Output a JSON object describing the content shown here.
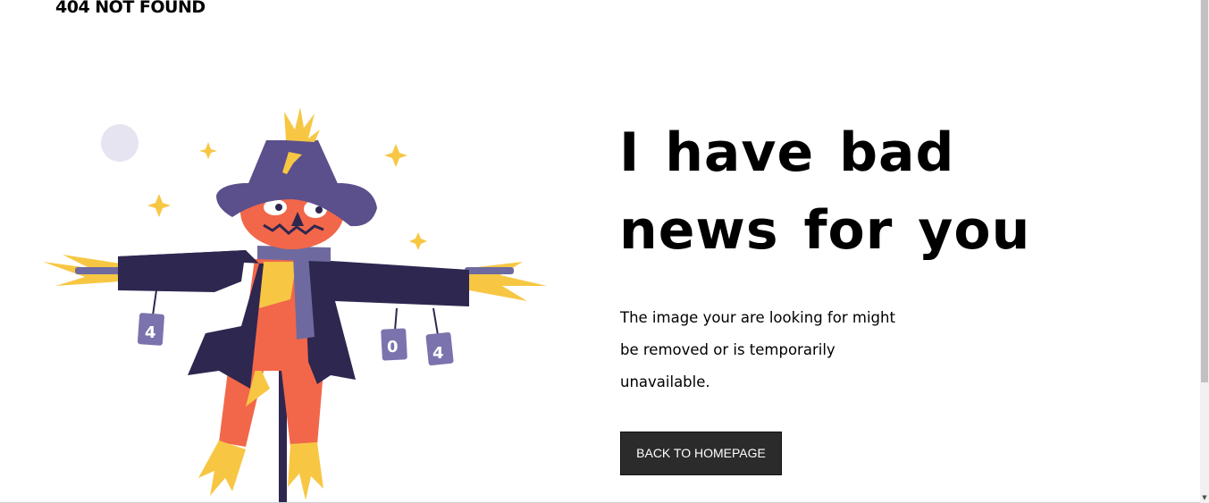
{
  "header": {
    "brand": "404 NOT FOUND"
  },
  "hero": {
    "headline": "I have bad news for you",
    "message": "The image your are looking for might be removed or is temporarily unavailable.",
    "button_label": "BACK TO HOMEPAGE"
  },
  "illustration": {
    "can_digits": [
      "4",
      "0",
      "4"
    ]
  },
  "colors": {
    "button_bg": "#2b2b2b",
    "hat": "#5b4f8c",
    "coat": "#2e2750",
    "face": "#f2674a",
    "straw": "#f7c744",
    "moon": "#e5e4f0"
  },
  "scrollbar": {
    "down_arrow": "▼"
  }
}
